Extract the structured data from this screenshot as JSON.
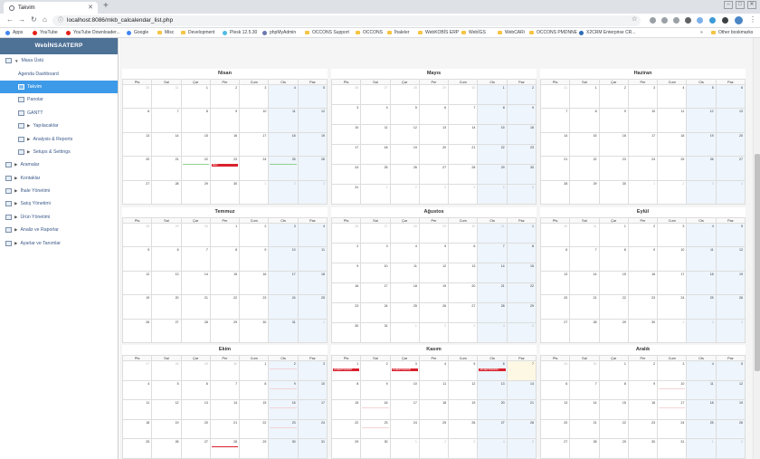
{
  "browser": {
    "tab_title": "Takvim",
    "new_tab": "+",
    "url": "localhost:8086/mkb_calcalendar_list.php",
    "bookmarks": [
      {
        "label": "Apps",
        "icon": "apps-icon"
      },
      {
        "label": "YouTube",
        "icon": "youtube-icon"
      },
      {
        "label": "YouTube Downloader...",
        "icon": "youtube-icon"
      },
      {
        "label": "Google",
        "icon": "google-icon"
      },
      {
        "label": "Misc",
        "icon": "folder-icon"
      },
      {
        "label": "Development",
        "icon": "folder-icon"
      },
      {
        "label": "Plesk 12.5.30",
        "icon": "plesk-icon"
      },
      {
        "label": "phpMyAdmin",
        "icon": "phpmyadmin-icon"
      },
      {
        "label": "OCCONS Support",
        "icon": "folder-icon"
      },
      {
        "label": "OCCONS",
        "icon": "folder-icon"
      },
      {
        "label": "İhaleler",
        "icon": "folder-icon"
      },
      {
        "label": "WebKOBİS ERP",
        "icon": "folder-icon"
      },
      {
        "label": "WebİGS",
        "icon": "folder-icon"
      },
      {
        "label": "WebCARi",
        "icon": "folder-icon"
      },
      {
        "label": "OCCONS PMDNNE",
        "icon": "folder-icon"
      },
      {
        "label": "X2CRM Enterprise CR...",
        "icon": "x2crm-icon"
      }
    ],
    "more_bookmarks": "»",
    "other_bookmarks": "Other bookmarks"
  },
  "sidebar": {
    "brand": "WebİNSAATERP",
    "items": [
      {
        "label": "Masa Üstü",
        "icon": "desktop-icon",
        "level": 0,
        "arrow": "▼",
        "active": false
      },
      {
        "label": "Agenda Dashboard",
        "icon": "",
        "level": 1,
        "arrow": "",
        "active": false
      },
      {
        "label": "Takvim",
        "icon": "calendar-icon",
        "level": 1,
        "arrow": "",
        "active": true
      },
      {
        "label": "Panolar",
        "icon": "board-icon",
        "level": 1,
        "arrow": "",
        "active": false
      },
      {
        "label": "GANTT",
        "icon": "gantt-icon",
        "level": 1,
        "arrow": "",
        "active": false
      },
      {
        "label": "Yapılacaklar",
        "icon": "todo-icon",
        "level": 1,
        "arrow": "▶",
        "active": false
      },
      {
        "label": "Analysis & Reports",
        "icon": "chart-icon",
        "level": 1,
        "arrow": "▶",
        "active": false
      },
      {
        "label": "Setups & Settings",
        "icon": "wrench-icon",
        "level": 1,
        "arrow": "▶",
        "active": false
      },
      {
        "label": "Aramalar",
        "icon": "phone-icon",
        "level": 0,
        "arrow": "▶",
        "active": false
      },
      {
        "label": "Kontaklar",
        "icon": "contacts-icon",
        "level": 0,
        "arrow": "▶",
        "active": false
      },
      {
        "label": "İhale Yönetimi",
        "icon": "tender-icon",
        "level": 0,
        "arrow": "▶",
        "active": false
      },
      {
        "label": "Satış Yönetimi",
        "icon": "sales-icon",
        "level": 0,
        "arrow": "▶",
        "active": false
      },
      {
        "label": "Ürün Yönetimi",
        "icon": "product-icon",
        "level": 0,
        "arrow": "▶",
        "active": false
      },
      {
        "label": "Analiz ve Raporlar",
        "icon": "chart-icon",
        "level": 0,
        "arrow": "▶",
        "active": false
      },
      {
        "label": "Ayarlar ve Tanımlar",
        "icon": "wrench-icon",
        "level": 0,
        "arrow": "▶",
        "active": false
      }
    ]
  },
  "calendar": {
    "weekdays": [
      "Pts",
      "Sal",
      "Çar",
      "Per",
      "Cum",
      "Cts",
      "Paz"
    ],
    "months": [
      {
        "name": "Nisan",
        "first_weekday": 2,
        "days": 30,
        "prev_days": 31
      },
      {
        "name": "Mayıs",
        "first_weekday": 5,
        "days": 31,
        "prev_days": 30
      },
      {
        "name": "Haziran",
        "first_weekday": 1,
        "days": 30,
        "prev_days": 31
      },
      {
        "name": "Temmuz",
        "first_weekday": 3,
        "days": 31,
        "prev_days": 30
      },
      {
        "name": "Ağustos",
        "first_weekday": 6,
        "days": 31,
        "prev_days": 31
      },
      {
        "name": "Eylül",
        "first_weekday": 2,
        "days": 30,
        "prev_days": 31
      },
      {
        "name": "Ekim",
        "first_weekday": 4,
        "days": 31,
        "prev_days": 30
      },
      {
        "name": "Kasım",
        "first_weekday": 0,
        "days": 30,
        "prev_days": 31
      },
      {
        "name": "Aralık",
        "first_weekday": 2,
        "days": 31,
        "prev_days": 30
      }
    ],
    "events": [
      {
        "month": 0,
        "day": 23,
        "label": "Mehi",
        "color": "#d9202d"
      },
      {
        "month": 7,
        "day": 1,
        "label": "2019ERT0000007",
        "color": "#d9202d"
      },
      {
        "month": 7,
        "day": 3,
        "label": "2019ERT0000005",
        "color": "#d9202d"
      },
      {
        "month": 7,
        "day": 6,
        "label": "2019ERT0000004",
        "color": "#d9202d"
      }
    ],
    "highlights": [
      {
        "month": 0,
        "day": 22,
        "color": "#8fd18f"
      },
      {
        "month": 0,
        "day": 25,
        "color": "#8fd18f"
      },
      {
        "month": 6,
        "day": 28,
        "color": "#d9202d"
      },
      {
        "month": 6,
        "day": 2,
        "color": "#f3d3d6"
      },
      {
        "month": 6,
        "day": 9,
        "color": "#f3d3d6"
      },
      {
        "month": 6,
        "day": 16,
        "color": "#f3d3d6"
      },
      {
        "month": 6,
        "day": 23,
        "color": "#f3d3d6"
      },
      {
        "month": 7,
        "day": 16,
        "color": "#f3d3d6"
      },
      {
        "month": 7,
        "day": 23,
        "color": "#f3d3d6"
      },
      {
        "month": 8,
        "day": 10,
        "color": "#f3d3d6"
      },
      {
        "month": 8,
        "day": 17,
        "color": "#f3d3d6"
      }
    ],
    "today": {
      "month": 7,
      "day": 7
    },
    "colors": {
      "weekend": "#eef5fc",
      "today": "#fdf8e3",
      "event": "#d9202d",
      "active_menu": "#3d9ae8",
      "brand": "#4e7196"
    }
  }
}
